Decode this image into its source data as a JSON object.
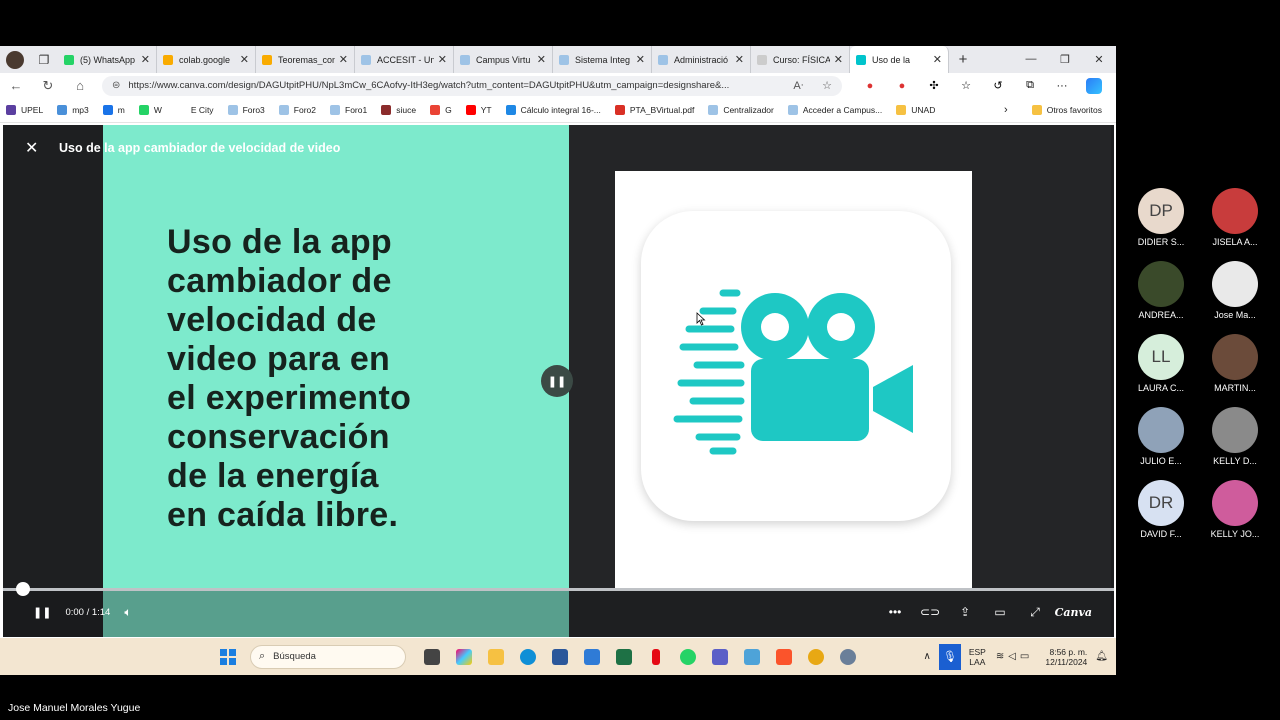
{
  "browser": {
    "tabs": [
      {
        "label": "(5) WhatsApp",
        "color": "#25d366"
      },
      {
        "label": "colab.google",
        "color": "#f9ab00"
      },
      {
        "label": "Teoremas_con",
        "color": "#f9ab00"
      },
      {
        "label": "ACCESIT - Uni",
        "color": "#9ec3e6"
      },
      {
        "label": "Campus Virtu",
        "color": "#9ec3e6"
      },
      {
        "label": "Sistema Integ",
        "color": "#9ec3e6"
      },
      {
        "label": "Administració",
        "color": "#9ec3e6"
      },
      {
        "label": "Curso: FÍSICA",
        "color": "#cccccc"
      },
      {
        "label": "Uso de la",
        "color": "#00c4cc"
      }
    ],
    "url": "https://www.canva.com/design/DAGUtpitPHU/NpL3mCw_6CAofvy-ItH3eg/watch?utm_content=DAGUtpitPHU&utm_campaign=designshare&...",
    "bookmarks": [
      {
        "label": "UPEL",
        "color": "#5b3fa0"
      },
      {
        "label": "mp3",
        "color": "#4a90d9"
      },
      {
        "label": "m",
        "color": "#1a73e8"
      },
      {
        "label": "W",
        "color": "#25d366"
      },
      {
        "label": "E City",
        "color": "#ffffff"
      },
      {
        "label": "Foro3",
        "color": "#9ec3e6"
      },
      {
        "label": "Foro2",
        "color": "#9ec3e6"
      },
      {
        "label": "Foro1",
        "color": "#9ec3e6"
      },
      {
        "label": "siuce",
        "color": "#8b2c2c"
      },
      {
        "label": "G",
        "color": "#ea4335"
      },
      {
        "label": "YT",
        "color": "#ff0000"
      },
      {
        "label": "Cálculo integral 16-...",
        "color": "#1e88e5"
      },
      {
        "label": "PTA_BVirtual.pdf",
        "color": "#d93025"
      },
      {
        "label": "Centralizador",
        "color": "#9ec3e6"
      },
      {
        "label": "Acceder a Campus...",
        "color": "#9ec3e6"
      },
      {
        "label": "UNAD",
        "color": "#f6c142"
      }
    ],
    "other_bookmarks": "Otros favoritos"
  },
  "viewer": {
    "title": "Uso de la app cambiador de velocidad de video",
    "slide_text": "Uso de la app\ncambiador de\nvelocidad de\nvideo para en\nel experimento\nconservación\nde la energía\nen caída libre.",
    "time": "0:00 / 1:14",
    "progress": 0.0,
    "brand": "Canva",
    "accent": "#7deacc",
    "icon_color": "#1ec8c4"
  },
  "taskbar": {
    "search_placeholder": "Búsqueda",
    "lang_top": "ESP",
    "lang_bottom": "LAA",
    "time": "8:56 p. m.",
    "date": "12/11/2024"
  },
  "participants": [
    {
      "initials": "DP",
      "name": "DIDIER S...",
      "bg": "#e8d9cc"
    },
    {
      "initials": "",
      "name": "JISELA A...",
      "bg": "#c83c3c"
    },
    {
      "initials": "",
      "name": "ANDREA...",
      "bg": "#3a4a2a"
    },
    {
      "initials": "",
      "name": "Jose Ma...",
      "bg": "#e9e9e9"
    },
    {
      "initials": "LL",
      "name": "LAURA C...",
      "bg": "#d6eedb"
    },
    {
      "initials": "",
      "name": "MARTIN...",
      "bg": "#6b4b3a"
    },
    {
      "initials": "",
      "name": "JULIO E...",
      "bg": "#8fa2b8"
    },
    {
      "initials": "",
      "name": "KELLY D...",
      "bg": "#8a8a8a"
    },
    {
      "initials": "DR",
      "name": "DAVID F...",
      "bg": "#d7e1f2"
    },
    {
      "initials": "",
      "name": "KELLY JO...",
      "bg": "#cf5c9c"
    }
  ],
  "presenter_name": "Jose Manuel Morales Yugue"
}
